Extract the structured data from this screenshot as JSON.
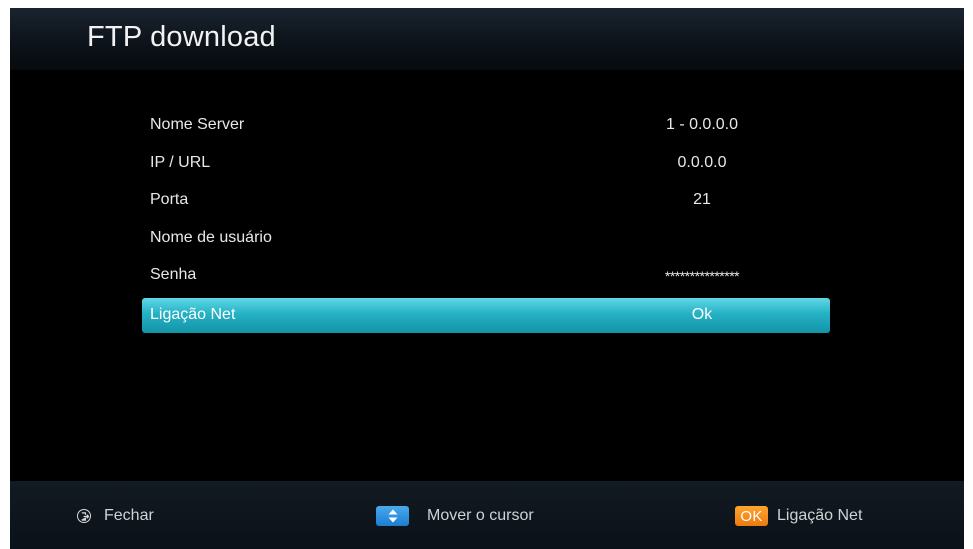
{
  "header": {
    "title": "FTP download"
  },
  "menu": {
    "rows": [
      {
        "label": "Nome Server",
        "value": "1 - 0.0.0.0"
      },
      {
        "label": "IP / URL",
        "value": "0.0.0.0"
      },
      {
        "label": "Porta",
        "value": "21"
      },
      {
        "label": "Nome de usuário",
        "value": ""
      },
      {
        "label": "Senha",
        "value": "***************"
      },
      {
        "label": "Ligação Net",
        "value": "Ok"
      }
    ],
    "selected_index": 5
  },
  "footer": {
    "exit_label": "Fechar",
    "exit_icon": "exit-icon",
    "move_label": "Mover o cursor",
    "move_icon": "up-down-arrows-icon",
    "ok_key_label": "OK",
    "ok_label": "Ligação Net"
  },
  "colors": {
    "highlight": "#25b1c4",
    "ok_key": "#ec7a10",
    "nav_key": "#1b7ed0"
  }
}
